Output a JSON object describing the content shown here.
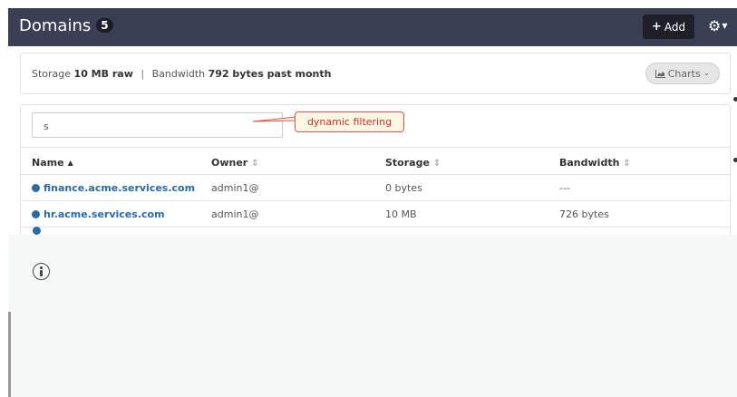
{
  "header": {
    "title": "Domains",
    "count": "5",
    "add_label": "Add",
    "add_icon": "plus-icon",
    "settings_icon": "gear-icon"
  },
  "storage": {
    "storage_label": "Storage",
    "storage_value": "10 MB raw",
    "separator": "|",
    "bandwidth_label": "Bandwidth",
    "bandwidth_value": "792 bytes past month",
    "charts_label": "Charts",
    "charts_icon": "area-chart-icon"
  },
  "filter": {
    "value": "s",
    "callout": "dynamic filtering"
  },
  "table": {
    "columns": [
      "Name",
      "Owner",
      "Storage",
      "Bandwidth"
    ],
    "rows": [
      {
        "name": "finance.acme.services.com",
        "owner": "admin1@",
        "storage": "0 bytes",
        "bandwidth": "---"
      },
      {
        "name": "hr.acme.services.com",
        "owner": "admin1@",
        "storage": "10 MB",
        "bandwidth": "726 bytes"
      }
    ]
  },
  "colors": {
    "header_bg": "#3b3f54",
    "link": "#2a6aa8",
    "callout_border": "#d9534f",
    "callout_bg": "#fcf8e3"
  }
}
